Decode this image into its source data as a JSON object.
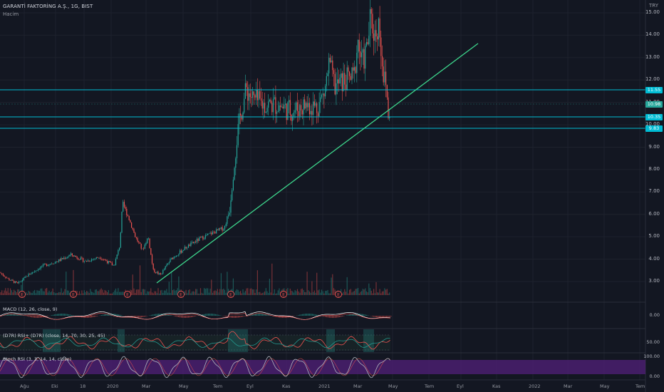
{
  "symbol": {
    "title": "GARANTİ FAKTORİNG A.Ş., 1G, BIST",
    "volume_label": "Hacim",
    "currency": "TRY"
  },
  "price_axis": [
    "15.00",
    "14.00",
    "13.00",
    "12.00",
    "11.00",
    "10.00",
    "9.00",
    "8.00",
    "7.00",
    "6.00",
    "5.00",
    "4.00",
    "3.00"
  ],
  "price_tags": [
    {
      "value": "11.55",
      "color": "#00bcd4"
    },
    {
      "value": "10.98",
      "color": "#26a69a"
    },
    {
      "value": "10.35",
      "color": "#00bcd4"
    },
    {
      "value": "9.83",
      "color": "#00bcd4"
    }
  ],
  "time_axis": [
    "Ağu",
    "Eki",
    "18",
    "2020",
    "Mar",
    "May",
    "Tem",
    "Eyl",
    "Kas",
    "2021",
    "Mar",
    "May",
    "Tem",
    "Eyl",
    "Kas",
    "2022",
    "Mar",
    "May",
    "Tem"
  ],
  "earnings_marker": "E",
  "indicators": {
    "macd": {
      "label": "MACD (12, 26, close, 9)",
      "axis": "0.00"
    },
    "rsi": {
      "label": "(D7R) RSI+ (D7R) (close, 14, 70, 30, 25, 45)",
      "axis": "50.00"
    },
    "stoch": {
      "label": "Stoch RSI (3, 3, 14, 14, close)",
      "axis_top": "100.00",
      "axis_bottom": "0.00"
    }
  },
  "colors": {
    "bg": "#131722",
    "up": "#26a69a",
    "down": "#ef5350",
    "hline": "#00bcd4",
    "trend": "#3dd68c",
    "stoch_band": "#4a1f6e"
  }
}
